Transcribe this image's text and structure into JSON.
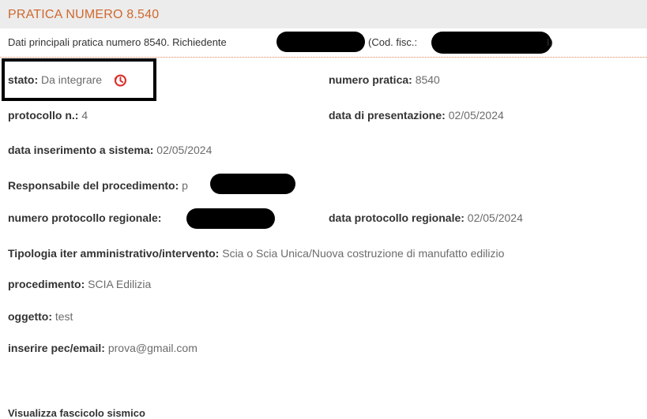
{
  "header": {
    "title": "PRATICA NUMERO 8.540"
  },
  "summary": {
    "prefix": "Dati principali pratica numero 8540. Richiedente",
    "codfisc_label": "(Cod. fisc.:",
    "codfisc_tail": "I)"
  },
  "fields": {
    "stato_label": "stato:",
    "stato_value": "Da integrare",
    "numero_pratica_label": "numero pratica:",
    "numero_pratica_value": "8540",
    "protocollo_label": "protocollo n.:",
    "protocollo_value": "4",
    "data_presentazione_label": "data di presentazione:",
    "data_presentazione_value": "02/05/2024",
    "data_inserimento_label": "data inserimento a sistema:",
    "data_inserimento_value": "02/05/2024",
    "responsabile_label": "Responsabile del procedimento:",
    "responsabile_value_visible": "p",
    "numero_protocollo_regionale_label": "numero protocollo regionale:",
    "data_protocollo_regionale_label": "data protocollo regionale:",
    "data_protocollo_regionale_value": "02/05/2024",
    "tipologia_label": "Tipologia iter amministrativo/intervento:",
    "tipologia_value": "Scia o Scia Unica/Nuova costruzione di manufatto edilizio",
    "procedimento_label": "procedimento:",
    "procedimento_value": "SCIA Edilizia",
    "oggetto_label": "oggetto:",
    "oggetto_value": "test",
    "pec_label": "inserire pec/email:",
    "pec_value": "prova@gmail.com"
  },
  "footer": {
    "partial_label": "Visualizza fascicolo sismico"
  },
  "icons": {
    "history": "history-icon"
  },
  "colors": {
    "title": "#d0682e",
    "icon": "#d9302c",
    "header_bg": "#ececec"
  }
}
